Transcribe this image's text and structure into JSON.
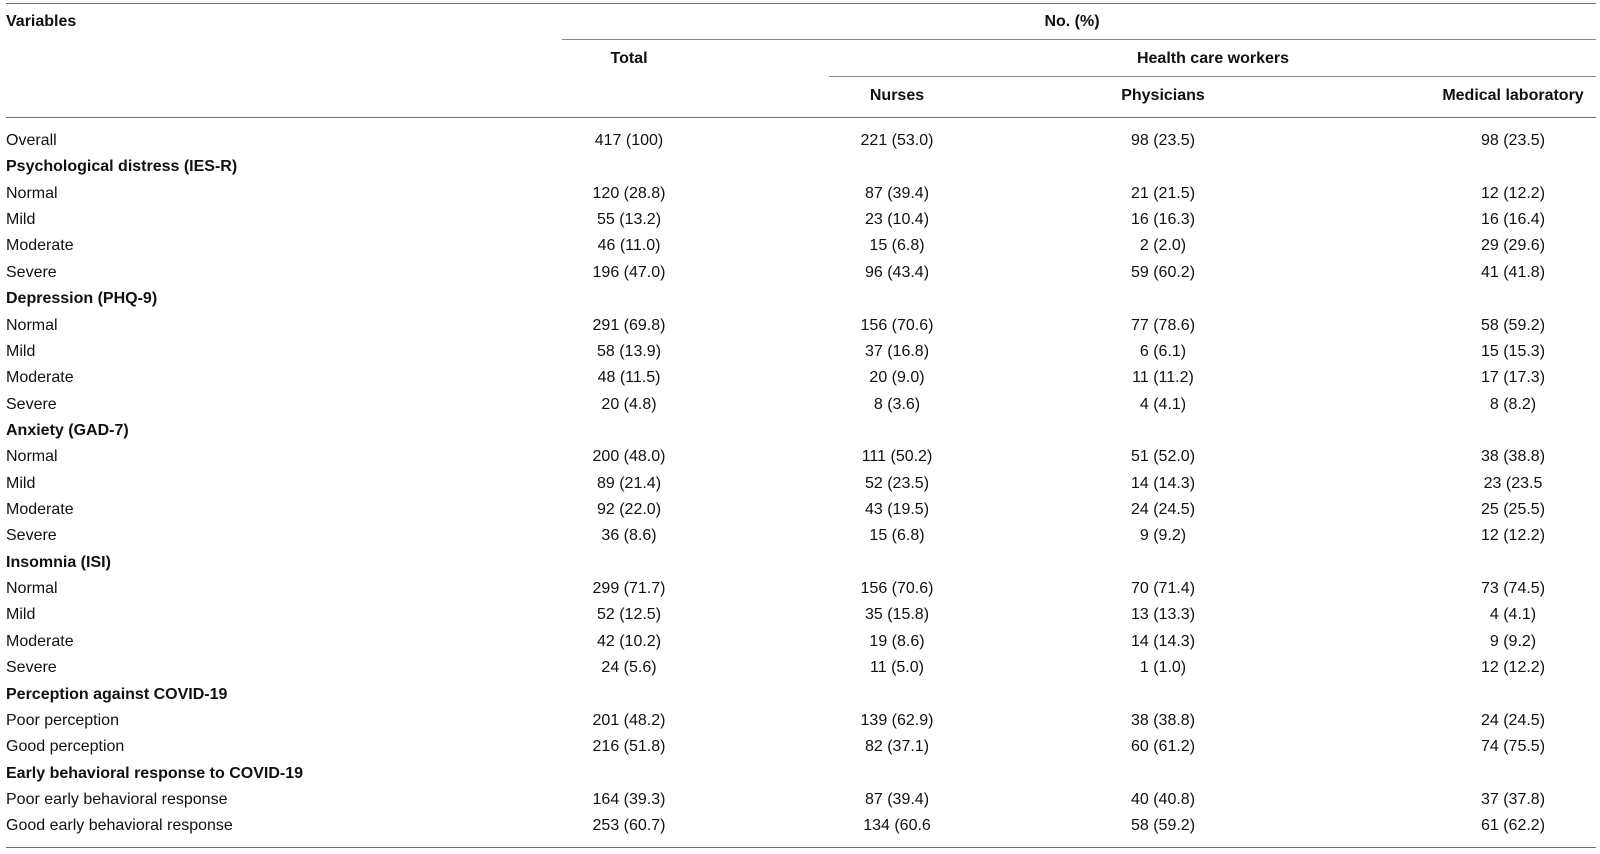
{
  "header": {
    "variables": "Variables",
    "no_pct": "No. (%)",
    "total": "Total",
    "hcw": "Health care workers",
    "nurses": "Nurses",
    "physicians": "Physicians",
    "medlab": "Medical laboratory"
  },
  "rows": [
    {
      "label": "Overall",
      "section": false,
      "values": [
        "417 (100)",
        "221 (53.0)",
        "98 (23.5)",
        "98 (23.5)"
      ]
    },
    {
      "label": "Psychological distress (IES-R)",
      "section": true,
      "values": [
        "",
        "",
        "",
        ""
      ]
    },
    {
      "label": "Normal",
      "section": false,
      "values": [
        "120 (28.8)",
        "87 (39.4)",
        "21 (21.5)",
        "12 (12.2)"
      ]
    },
    {
      "label": "Mild",
      "section": false,
      "values": [
        "55 (13.2)",
        "23 (10.4)",
        "16 (16.3)",
        "16 (16.4)"
      ]
    },
    {
      "label": "Moderate",
      "section": false,
      "values": [
        "46 (11.0)",
        "15 (6.8)",
        "2 (2.0)",
        "29 (29.6)"
      ]
    },
    {
      "label": "Severe",
      "section": false,
      "values": [
        "196 (47.0)",
        "96 (43.4)",
        "59 (60.2)",
        "41 (41.8)"
      ]
    },
    {
      "label": "Depression (PHQ-9)",
      "section": true,
      "values": [
        "",
        "",
        "",
        ""
      ]
    },
    {
      "label": "Normal",
      "section": false,
      "values": [
        "291 (69.8)",
        "156 (70.6)",
        "77 (78.6)",
        "58 (59.2)"
      ]
    },
    {
      "label": "Mild",
      "section": false,
      "values": [
        "58 (13.9)",
        "37 (16.8)",
        "6 (6.1)",
        "15 (15.3)"
      ]
    },
    {
      "label": "Moderate",
      "section": false,
      "values": [
        "48 (11.5)",
        "20 (9.0)",
        "11 (11.2)",
        "17 (17.3)"
      ]
    },
    {
      "label": "Severe",
      "section": false,
      "values": [
        "20 (4.8)",
        "8 (3.6)",
        "4 (4.1)",
        "8 (8.2)"
      ]
    },
    {
      "label": "Anxiety (GAD-7)",
      "section": true,
      "values": [
        "",
        "",
        "",
        ""
      ]
    },
    {
      "label": "Normal",
      "section": false,
      "values": [
        "200 (48.0)",
        "111 (50.2)",
        "51 (52.0)",
        "38 (38.8)"
      ]
    },
    {
      "label": "Mild",
      "section": false,
      "values": [
        "89 (21.4)",
        "52 (23.5)",
        "14 (14.3)",
        "23 (23.5"
      ]
    },
    {
      "label": "Moderate",
      "section": false,
      "values": [
        "92 (22.0)",
        "43 (19.5)",
        "24 (24.5)",
        "25 (25.5)"
      ]
    },
    {
      "label": "Severe",
      "section": false,
      "values": [
        "36 (8.6)",
        "15 (6.8)",
        "9 (9.2)",
        "12 (12.2)"
      ]
    },
    {
      "label": "Insomnia (ISI)",
      "section": true,
      "values": [
        "",
        "",
        "",
        ""
      ]
    },
    {
      "label": "Normal",
      "section": false,
      "values": [
        "299 (71.7)",
        "156 (70.6)",
        "70 (71.4)",
        "73 (74.5)"
      ]
    },
    {
      "label": "Mild",
      "section": false,
      "values": [
        "52 (12.5)",
        "35 (15.8)",
        "13 (13.3)",
        "4 (4.1)"
      ]
    },
    {
      "label": "Moderate",
      "section": false,
      "values": [
        "42 (10.2)",
        "19 (8.6)",
        "14 (14.3)",
        "9 (9.2)"
      ]
    },
    {
      "label": "Severe",
      "section": false,
      "values": [
        "24 (5.6)",
        "11 (5.0)",
        "1 (1.0)",
        "12 (12.2)"
      ]
    },
    {
      "label": "Perception against COVID-19",
      "section": true,
      "values": [
        "",
        "",
        "",
        ""
      ]
    },
    {
      "label": "Poor perception",
      "section": false,
      "values": [
        "201 (48.2)",
        "139 (62.9)",
        "38 (38.8)",
        "24 (24.5)"
      ]
    },
    {
      "label": "Good perception",
      "section": false,
      "values": [
        "216 (51.8)",
        "82 (37.1)",
        "60 (61.2)",
        "74 (75.5)"
      ]
    },
    {
      "label": "Early behavioral response to COVID-19",
      "section": true,
      "values": [
        "",
        "",
        "",
        ""
      ]
    },
    {
      "label": "Poor early behavioral response",
      "section": false,
      "values": [
        "164 (39.3)",
        "87 (39.4)",
        "40 (40.8)",
        "37 (37.8)"
      ]
    },
    {
      "label": "Good early behavioral response",
      "section": false,
      "values": [
        "253 (60.7)",
        "134 (60.6",
        "58 (59.2)",
        "61 (62.2)"
      ]
    }
  ]
}
